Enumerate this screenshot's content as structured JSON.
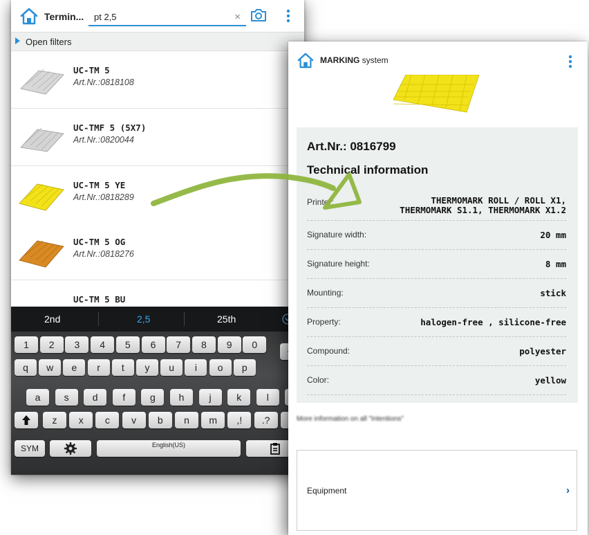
{
  "left_screen": {
    "app_title": "Termin...",
    "search": {
      "value": "pt 2,5"
    },
    "clear_icon": "×",
    "filters_label": "Open filters",
    "products": [
      {
        "name": "UC-TM 5",
        "art": "Art.Nr.:0818108",
        "color": "#d8d8d8"
      },
      {
        "name": "UC-TMF 5 (5X7)",
        "art": "Art.Nr.:0820044",
        "color": "#d4d4d4"
      },
      {
        "name": "UC-TM 5 YE",
        "art": "Art.Nr.:0818289",
        "color": "#f2e21a"
      },
      {
        "name": "UC-TM 5 OG",
        "art": "Art.Nr.:0818276",
        "color": "#d98a22"
      },
      {
        "name": "UC-TM 5 BU",
        "art": "",
        "color": "#2c5da8"
      }
    ],
    "chevron": "›",
    "keyboard": {
      "suggestions": [
        "2nd",
        "2,5",
        "25th"
      ],
      "row1": [
        "1",
        "2",
        "3",
        "4",
        "5",
        "6",
        "7",
        "8",
        "9",
        "0"
      ],
      "row2": [
        "q",
        "w",
        "e",
        "r",
        "t",
        "y",
        "u",
        "i",
        "o",
        "p"
      ],
      "row3": [
        "a",
        "s",
        "d",
        "f",
        "g",
        "h",
        "j",
        "k",
        "l"
      ],
      "row4": [
        "z",
        "x",
        "c",
        "v",
        "b",
        "n",
        "m",
        ",!",
        ".?"
      ],
      "sym": "SYM",
      "space_label": "English(US)"
    }
  },
  "right_screen": {
    "title_bold": "MARKING",
    "title_rest": " system",
    "art_nr": "Art.Nr.: 0816799",
    "tech_heading": "Technical information",
    "specs": [
      {
        "label": "Printer:",
        "value": "THERMOMARK ROLL / ROLL X1,\nTHERMOMARK S1.1, THERMOMARK X1.2"
      },
      {
        "label": "Signature width:",
        "value": "20 mm"
      },
      {
        "label": "Signature height:",
        "value": "8 mm"
      },
      {
        "label": "Mounting:",
        "value": "stick"
      },
      {
        "label": "Property:",
        "value": "halogen-free , silicone-free"
      },
      {
        "label": "Compound:",
        "value": "polyester"
      },
      {
        "label": "Color:",
        "value": "yellow"
      }
    ],
    "more_info": "More information on all \"Intentions\"",
    "equipment_label": "Equipment",
    "chevron": "›"
  },
  "colors": {
    "accent": "#2a8fd6",
    "chevron": "#0c5a9a",
    "panel": "#ecf0ef",
    "arrow": "#8db43a",
    "thumb_yellow": "#f2e21a"
  }
}
